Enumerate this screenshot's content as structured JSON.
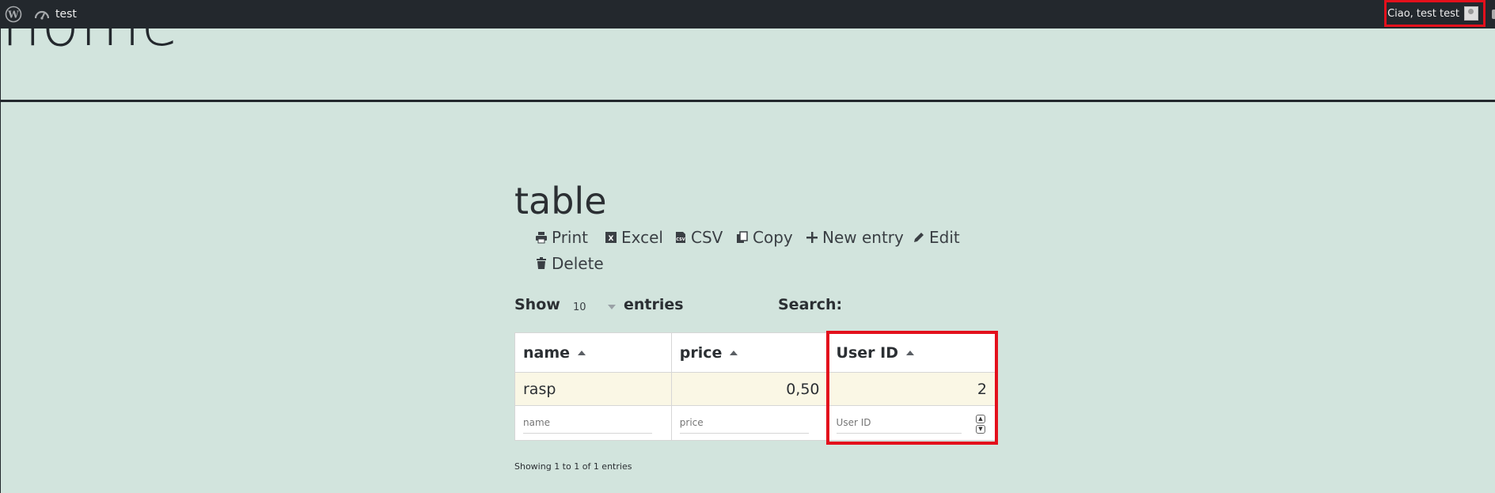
{
  "admin_bar": {
    "site_name": "test",
    "greeting": "Ciao, test test"
  },
  "site": {
    "title": "home"
  },
  "page": {
    "heading": "table"
  },
  "toolbar": {
    "print": "Print",
    "excel": "Excel",
    "csv": "CSV",
    "copy": "Copy",
    "new_entry": "New entry",
    "edit": "Edit",
    "delete": "Delete"
  },
  "controls": {
    "show": "Show",
    "page_length": "10",
    "entries": "entries",
    "search": "Search:"
  },
  "table": {
    "columns": [
      "name",
      "price",
      "User ID"
    ],
    "rows": [
      {
        "name": "rasp",
        "price": "0,50",
        "user_id": "2"
      }
    ],
    "filters": {
      "name": "name",
      "price": "price",
      "user_id": "User ID"
    }
  },
  "info": "Showing 1 to 1 of 1 entries",
  "colors": {
    "highlight": "#e3101c",
    "background": "#d2e4dd",
    "adminbar": "#23282d",
    "row_highlight": "#faf7e5"
  }
}
